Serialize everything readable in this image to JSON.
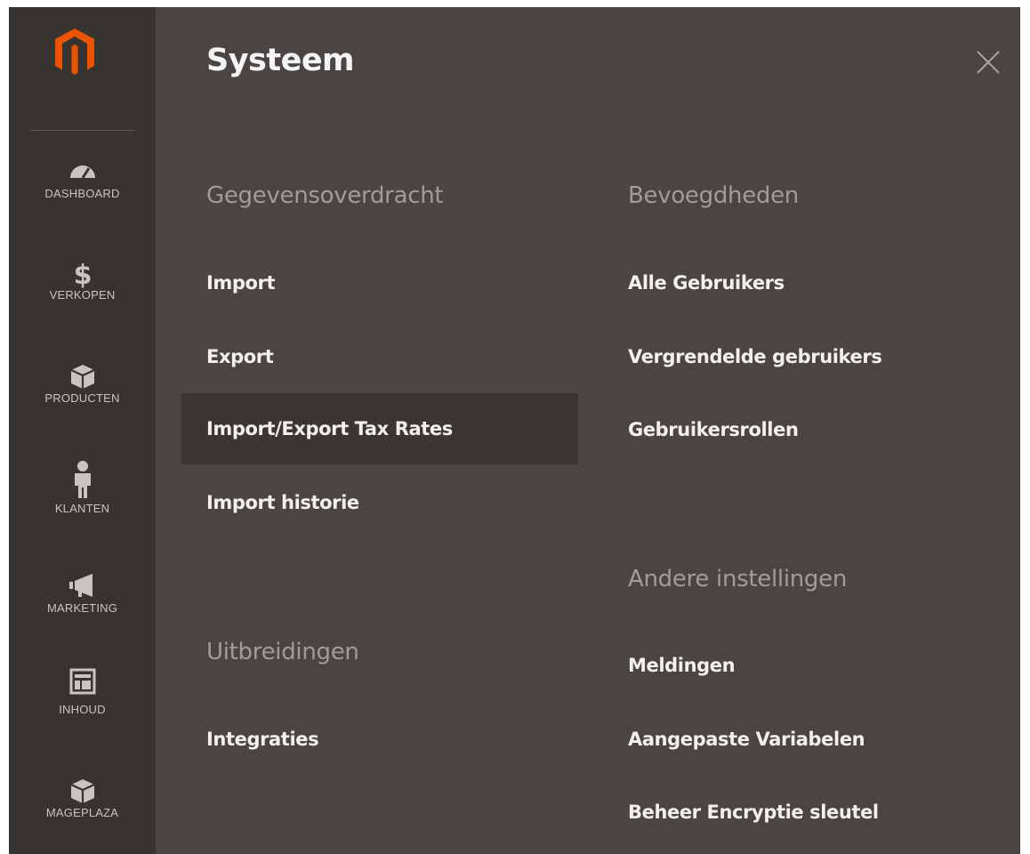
{
  "sidebar": {
    "logo": "magento-logo",
    "items": [
      {
        "label": "DASHBOARD",
        "icon": "dashboard-gauge-icon"
      },
      {
        "label": "VERKOPEN",
        "icon": "dollar-icon"
      },
      {
        "label": "PRODUCTEN",
        "icon": "cube-icon"
      },
      {
        "label": "KLANTEN",
        "icon": "person-icon"
      },
      {
        "label": "MARKETING",
        "icon": "megaphone-icon"
      },
      {
        "label": "INHOUD",
        "icon": "layout-icon"
      },
      {
        "label": "MAGEPLAZA",
        "icon": "cube-icon"
      }
    ]
  },
  "panel": {
    "title": "Systeem",
    "close_icon": "close-icon",
    "sections": {
      "gegevensoverdracht": {
        "title": "Gegevensoverdracht",
        "links": [
          "Import",
          "Export",
          "Import/Export Tax Rates",
          "Import historie"
        ]
      },
      "uitbreidingen": {
        "title": "Uitbreidingen",
        "links": [
          "Integraties"
        ]
      },
      "bevoegdheden": {
        "title": "Bevoegdheden",
        "links": [
          "Alle Gebruikers",
          "Vergrendelde gebruikers",
          "Gebruikersrollen"
        ]
      },
      "andere": {
        "title": "Andere instellingen",
        "links": [
          "Meldingen",
          "Aangepaste Variabelen",
          "Beheer Encryptie sleutel"
        ]
      }
    }
  },
  "colors": {
    "sidebar_bg": "#373330",
    "panel_bg": "#4a4542",
    "active_bg": "#3b3633",
    "logo_orange": "#eb5202",
    "section_title": "#a29c97"
  }
}
